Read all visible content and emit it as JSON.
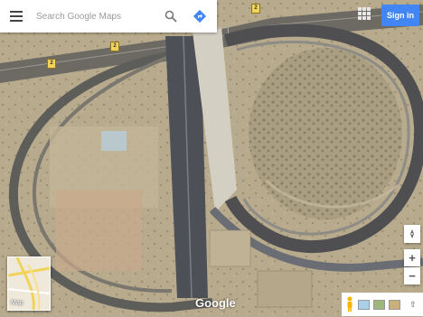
{
  "search": {
    "placeholder": "Search Google Maps"
  },
  "header": {
    "signin_label": "Sign in"
  },
  "route_badges": [
    "2",
    "2",
    "2"
  ],
  "minimap": {
    "label": "Map"
  },
  "attribution": {
    "logo_text": "Google"
  },
  "controls": {
    "zoom_in": "+",
    "zoom_out": "−"
  },
  "colors": {
    "signin_bg": "#4285f4",
    "direction_blue": "#4285f4",
    "road_yellow": "#f2d35a"
  },
  "icons": [
    "menu-icon",
    "search-icon",
    "directions-icon",
    "apps-grid-icon",
    "compass-icon",
    "pegman-icon",
    "expand-icon"
  ]
}
